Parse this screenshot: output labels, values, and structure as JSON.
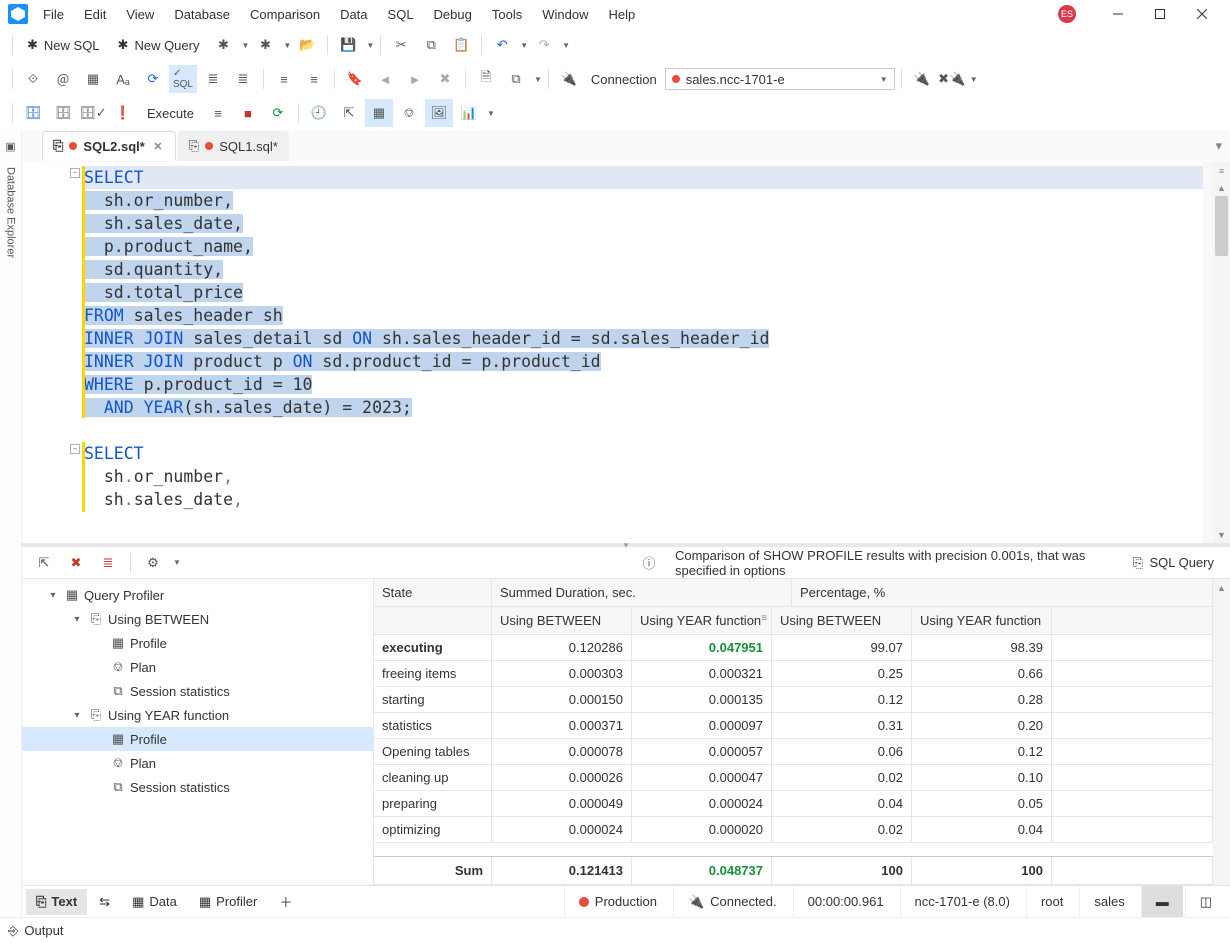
{
  "menu": {
    "items": [
      "File",
      "Edit",
      "View",
      "Database",
      "Comparison",
      "Data",
      "SQL",
      "Debug",
      "Tools",
      "Window",
      "Help"
    ]
  },
  "user_initials": "ES",
  "tb1": {
    "new_sql": "New SQL",
    "new_query": "New Query"
  },
  "tb2": {
    "connection_label": "Connection",
    "connection_value": "sales.ncc-1701-e"
  },
  "tb3": {
    "execute": "Execute"
  },
  "sidebar_tab": "Database Explorer",
  "editor_tabs": [
    {
      "name": "SQL2.sql*",
      "active": true
    },
    {
      "name": "SQL1.sql*",
      "active": false
    }
  ],
  "code_lines": [
    {
      "t": "SELECT",
      "kw": true,
      "sel": false,
      "hl": true
    },
    {
      "t": "  sh.or_number,",
      "kw": false,
      "sel": true
    },
    {
      "t": "  sh.sales_date,",
      "kw": false,
      "sel": true
    },
    {
      "t": "  p.product_name,",
      "kw": false,
      "sel": true
    },
    {
      "t": "  sd.quantity,",
      "kw": false,
      "sel": true
    },
    {
      "t": "  sd.total_price",
      "kw": false,
      "sel": true
    },
    {
      "t": "FROM sales_header sh",
      "kwp": "FROM",
      "rest": " sales_header sh",
      "sel": true
    },
    {
      "t": "INNER JOIN sales_detail sd ON sh.sales_header_id = sd.sales_header_id",
      "kwp": "INNER JOIN",
      "rest": " sales_detail sd ",
      "kw2": "ON",
      "rest2": " sh.sales_header_id = sd.sales_header_id",
      "sel": true
    },
    {
      "t": "INNER JOIN product p ON sd.product_id = p.product_id",
      "kwp": "INNER JOIN",
      "rest": " product p ",
      "kw2": "ON",
      "rest2": " sd.product_id = p.product_id",
      "sel": true
    },
    {
      "t": "WHERE p.product_id = 10",
      "kwp": "WHERE",
      "rest": " p.product_id = 10",
      "sel": true
    },
    {
      "t": "  AND YEAR(sh.sales_date) = 2023;",
      "kwp": "  AND YEAR",
      "rest": "(sh.sales_date) = 2023;",
      "sel": true
    },
    {
      "t": "",
      "sel": false
    },
    {
      "t": "SELECT",
      "kw": true,
      "sel": false
    },
    {
      "t": "  sh.or_number,",
      "sel": false,
      "punct": true
    },
    {
      "t": "  sh.sales_date,",
      "sel": false,
      "punct": true
    }
  ],
  "profiler": {
    "title": "Comparison of SHOW PROFILE results with precision 0.001s, that was specified in options",
    "sql_query_btn": "SQL Query",
    "tree": {
      "root": "Query Profiler",
      "groups": [
        {
          "name": "Using BETWEEN",
          "children": [
            "Profile",
            "Plan",
            "Session statistics"
          ]
        },
        {
          "name": "Using YEAR function",
          "children": [
            "Profile",
            "Plan",
            "Session statistics"
          ],
          "selected_child": 0
        }
      ]
    },
    "table": {
      "head1": [
        "State",
        "Summed Duration, sec.",
        "Percentage, %"
      ],
      "head2": [
        "Using BETWEEN",
        "Using YEAR function",
        "Using BETWEEN",
        "Using YEAR function"
      ],
      "rows": [
        {
          "state": "executing",
          "d1": "0.120286",
          "d2": "0.047951",
          "p1": "99.07",
          "p2": "98.39",
          "exec": true
        },
        {
          "state": "freeing items",
          "d1": "0.000303",
          "d2": "0.000321",
          "p1": "0.25",
          "p2": "0.66"
        },
        {
          "state": "starting",
          "d1": "0.000150",
          "d2": "0.000135",
          "p1": "0.12",
          "p2": "0.28"
        },
        {
          "state": "statistics",
          "d1": "0.000371",
          "d2": "0.000097",
          "p1": "0.31",
          "p2": "0.20"
        },
        {
          "state": "Opening tables",
          "d1": "0.000078",
          "d2": "0.000057",
          "p1": "0.06",
          "p2": "0.12"
        },
        {
          "state": "cleaning up",
          "d1": "0.000026",
          "d2": "0.000047",
          "p1": "0.02",
          "p2": "0.10"
        },
        {
          "state": "preparing",
          "d1": "0.000049",
          "d2": "0.000024",
          "p1": "0.04",
          "p2": "0.05"
        },
        {
          "state": "optimizing",
          "d1": "0.000024",
          "d2": "0.000020",
          "p1": "0.02",
          "p2": "0.04"
        }
      ],
      "sum": {
        "label": "Sum",
        "d1": "0.121413",
        "d2": "0.048737",
        "p1": "100",
        "p2": "100"
      }
    }
  },
  "footer": {
    "tabs": [
      {
        "label": "Text",
        "active": true
      },
      {
        "label": "Data"
      },
      {
        "label": "Profiler"
      }
    ],
    "env": "Production",
    "status": "Connected.",
    "time": "00:00:00.961",
    "server": "ncc-1701-e (8.0)",
    "user": "root",
    "db": "sales"
  },
  "output_label": "Output"
}
